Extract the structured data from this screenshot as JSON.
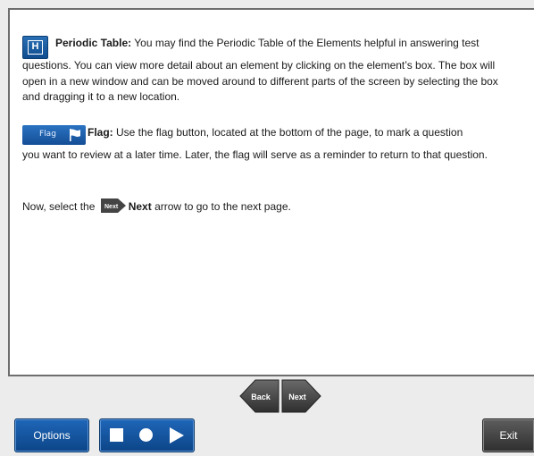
{
  "colors": {
    "accent_blue": "#1a5fa8",
    "nav_gray": "#4a4a4a",
    "exit_gray": "#3f3f3f"
  },
  "content": {
    "p1_title": "Periodic Table:",
    "p1_first": " You may find the Periodic Table of the Elements helpful in answering test",
    "p1_rest": "questions. You can view more detail about an element by clicking on the element’s box. The box will open in a new window and can be moved around to different parts of the screen by selecting the box and dragging it to a new location.",
    "h_icon_letter": "H",
    "flag_button_label": "Flag",
    "p2_title": "Flag:",
    "p2_first": " Use the flag button, located at the bottom of the page, to mark a question",
    "p2_rest": "you want to review at a later time. Later, the flag will serve as a reminder to return to that question.",
    "p3_before": "Now, select the ",
    "p3_icon_label": "Next",
    "p3_bold": "Next",
    "p3_after": " arrow to go to the next page."
  },
  "navigation": {
    "back_label": "Back",
    "next_label": "Next"
  },
  "footer": {
    "options_label": "Options",
    "media_icons": [
      "stop-icon",
      "record-icon",
      "play-icon"
    ],
    "exit_label": "Exit"
  }
}
